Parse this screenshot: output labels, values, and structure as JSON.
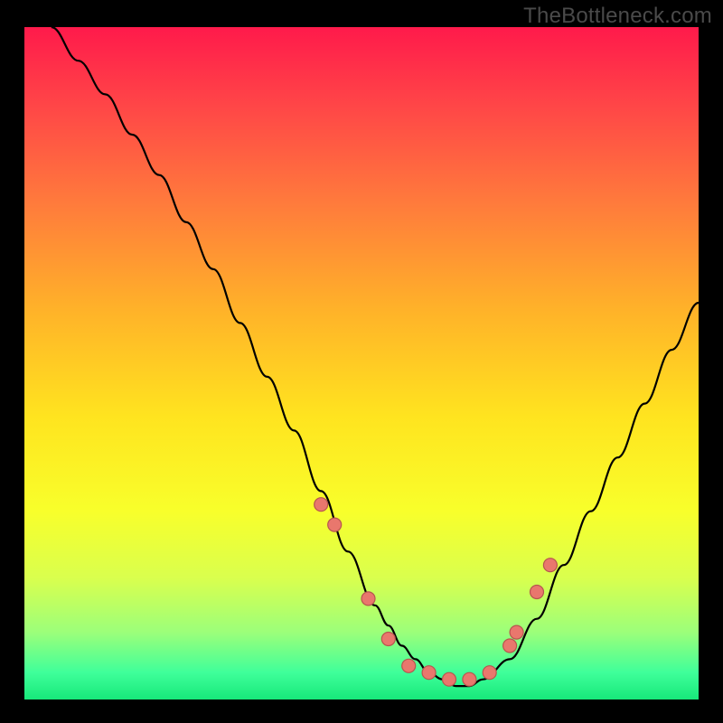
{
  "watermark": "TheBottleneck.com",
  "colors": {
    "background": "#000000",
    "gradient_top": "#ff1a4b",
    "gradient_bottom": "#17e87a",
    "curve": "#000000",
    "marker_fill": "#e9776d",
    "marker_stroke": "#b6564e"
  },
  "chart_data": {
    "type": "line",
    "title": "",
    "xlabel": "",
    "ylabel": "",
    "xlim": [
      0,
      100
    ],
    "ylim": [
      0,
      100
    ],
    "series": [
      {
        "name": "curve",
        "x": [
          4,
          8,
          12,
          16,
          20,
          24,
          28,
          32,
          36,
          40,
          44,
          48,
          52,
          54,
          56,
          58,
          60,
          62,
          64,
          66,
          68,
          72,
          76,
          80,
          84,
          88,
          92,
          96,
          100
        ],
        "y": [
          100,
          95,
          90,
          84,
          78,
          71,
          64,
          56,
          48,
          40,
          31,
          22,
          14,
          11,
          8,
          6,
          4,
          3,
          2,
          2,
          3,
          6,
          12,
          20,
          28,
          36,
          44,
          52,
          59
        ]
      }
    ],
    "markers": {
      "name": "trough-markers",
      "x": [
        44,
        46,
        51,
        54,
        57,
        60,
        63,
        66,
        69,
        72,
        73,
        76,
        78
      ],
      "y": [
        29,
        26,
        15,
        9,
        5,
        4,
        3,
        3,
        4,
        8,
        10,
        16,
        20
      ]
    }
  }
}
